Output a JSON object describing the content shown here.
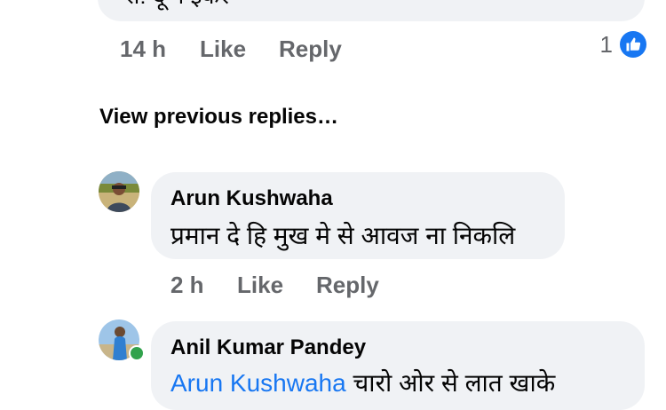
{
  "top_comment": {
    "partial_text": "रो! दू न ईकर",
    "time": "14 h",
    "like_label": "Like",
    "reply_label": "Reply",
    "reaction_count": "1"
  },
  "view_previous_label": "View previous replies…",
  "comments": [
    {
      "author": "Arun Kushwaha",
      "text": "प्रमान दे हि मुख मे से आवज ना निकलि",
      "time": "2 h",
      "like_label": "Like",
      "reply_label": "Reply"
    },
    {
      "author": "Anil Kumar Pandey",
      "mention": "Arun Kushwaha",
      "text": "चारो ओर से लात खाके"
    }
  ],
  "colors": {
    "bubble": "#f0f2f5",
    "meta": "#65676b",
    "accent": "#1877f2",
    "online": "#31a24c"
  },
  "icons": {
    "reaction": "like-thumb-icon",
    "presence": "online-status-icon"
  }
}
